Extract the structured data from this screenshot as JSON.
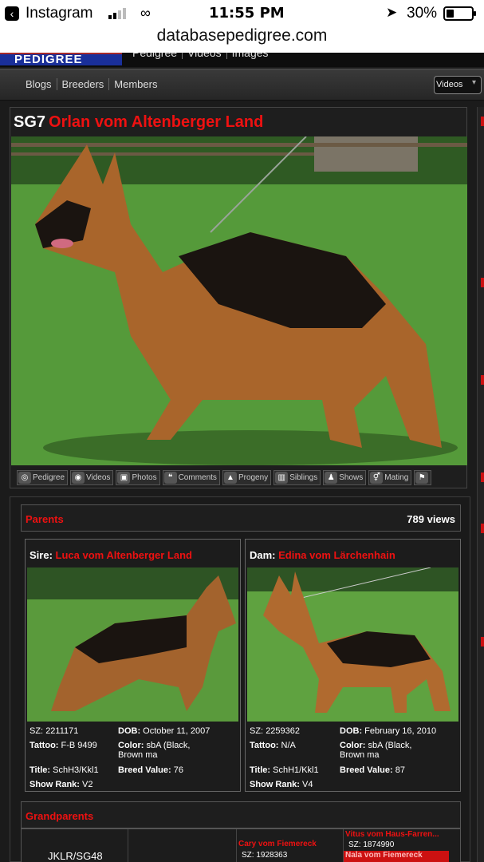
{
  "status_bar": {
    "back_app": "Instagram",
    "time": "11:55 PM",
    "battery": "30%",
    "url": "databasepedigree.com"
  },
  "site": {
    "logo": "PEDIGREE",
    "top_nav": [
      "Pedigree",
      "Videos",
      "Images"
    ],
    "nav": [
      "Blogs",
      "Breeders",
      "Members"
    ],
    "select": "Videos"
  },
  "dog": {
    "title_prefix": "SG7",
    "name": "Orlan vom Altenberger Land",
    "tabs": [
      "Pedigree",
      "Videos",
      "Photos",
      "Comments",
      "Progeny",
      "Siblings",
      "Shows",
      "Mating",
      ""
    ]
  },
  "parents": {
    "label": "Parents",
    "views": "789 views",
    "sire": {
      "role": "Sire:",
      "name": "Luca vom Altenberger Land",
      "sz_label": "SZ:",
      "sz": "2211171",
      "dob_label": "DOB:",
      "dob": "October 11, 2007",
      "tattoo_label": "Tattoo:",
      "tattoo": "F-B 9499",
      "color_label": "Color:",
      "color": "sbA (Black,",
      "color2": "Brown ma",
      "title_label": "Title:",
      "title": "SchH3/Kkl1",
      "breed_label": "Breed Value:",
      "breed": "76",
      "show_label": "Show Rank:",
      "show": "V2"
    },
    "dam": {
      "role": "Dam:",
      "name": "Edina vom Lärchenhain",
      "sz_label": "SZ:",
      "sz": "2259362",
      "dob_label": "DOB:",
      "dob": "February 16, 2010",
      "tattoo_label": "Tattoo:",
      "tattoo": "N/A",
      "color_label": "Color:",
      "color": "sbA (Black,",
      "color2": "Brown ma",
      "title_label": "Title:",
      "title": "SchH1/Kkl1",
      "breed_label": "Breed Value:",
      "breed": "87",
      "show_label": "Show Rank:",
      "show": "V4"
    }
  },
  "grandparents": {
    "label": "Grandparents",
    "row_title": "JKLR/SG48",
    "cary": {
      "name": "Cary vom Fiemereck",
      "sz": "SZ: 1928363"
    },
    "vitus": {
      "name": "Vitus vom Haus-Farren...",
      "sz": "SZ: 1874990"
    },
    "nala": "Nala vom Fiemereck"
  },
  "colors": {
    "accent": "#e11111",
    "background": "#1b1b1b"
  }
}
